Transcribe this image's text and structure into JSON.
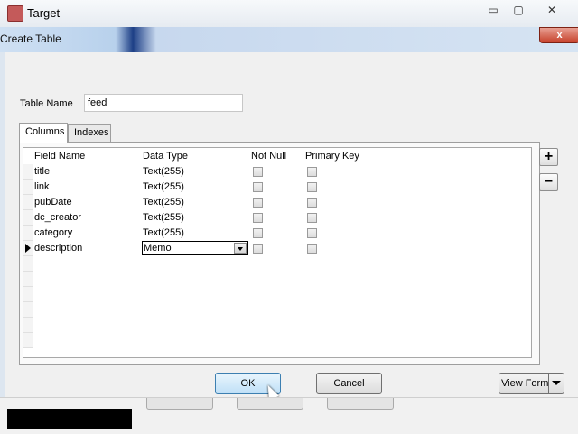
{
  "outer_window": {
    "title": "Target",
    "minimize": "▭",
    "maximize": "▢",
    "close": "✕"
  },
  "dialog": {
    "title": "Create Table",
    "close_label": "x",
    "table_name_label": "Table Name",
    "table_name_value": "feed",
    "tabs": [
      "Columns",
      "Indexes"
    ],
    "columns_header": [
      "Field Name",
      "Data Type",
      "Not Null",
      "Primary Key"
    ],
    "rows": [
      {
        "field": "title",
        "type": "Text(255)"
      },
      {
        "field": "link",
        "type": "Text(255)"
      },
      {
        "field": "pubDate",
        "type": "Text(255)"
      },
      {
        "field": "dc_creator",
        "type": "Text(255)"
      },
      {
        "field": "category",
        "type": "Text(255)"
      },
      {
        "field": "description",
        "type": "Memo"
      }
    ],
    "add_label": "+",
    "remove_label": "−",
    "ok_label": "OK",
    "cancel_label": "Cancel",
    "view_form_label": "View Form"
  }
}
